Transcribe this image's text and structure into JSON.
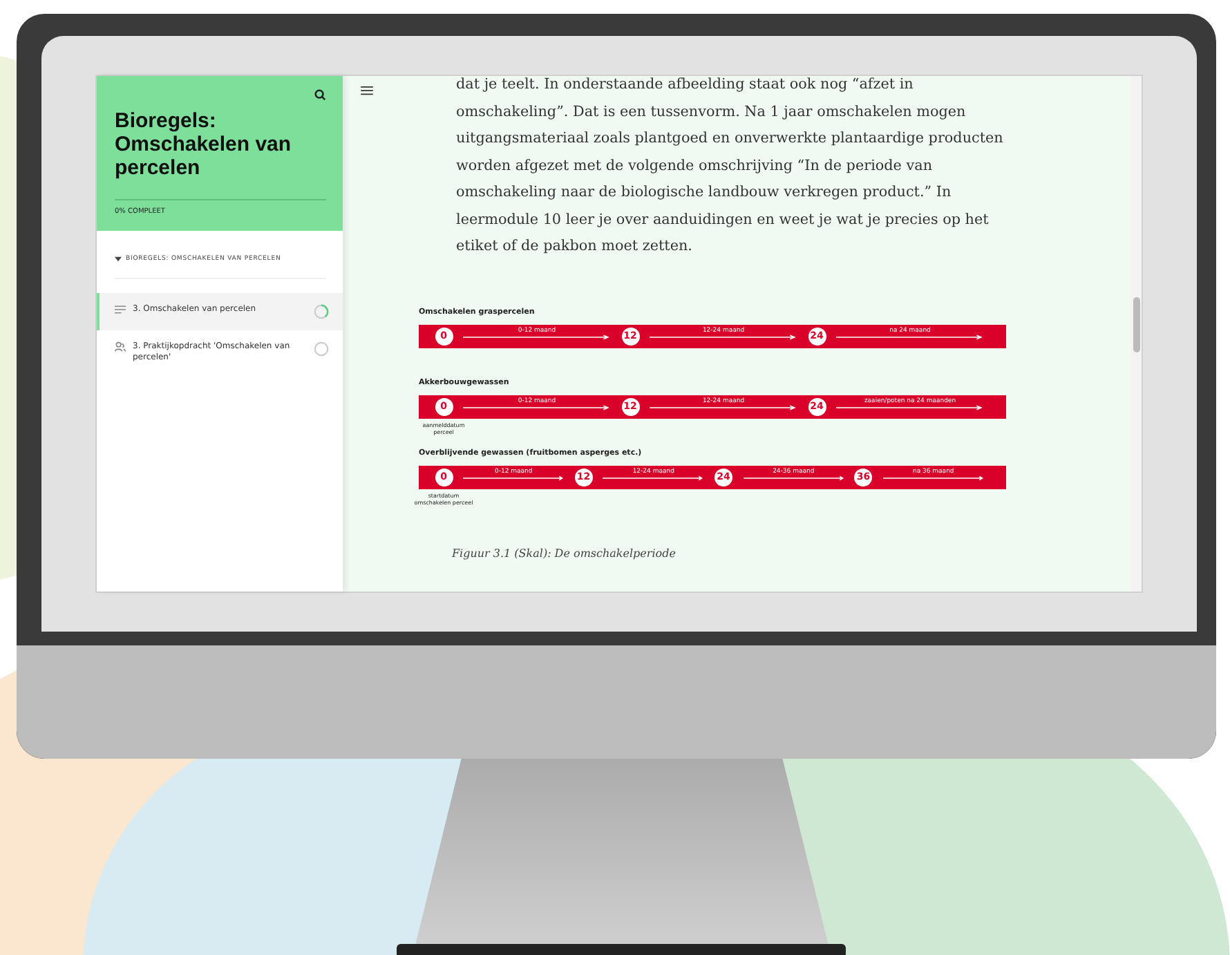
{
  "sidebar": {
    "title": "Bioregels: Omschakelen van percelen",
    "progress": "0% COMPLEET",
    "section": {
      "label": "BIOREGELS: OMSCHAKELEN VAN PERCELEN",
      "expanded": true
    },
    "items": [
      {
        "label": "3. Omschakelen van percelen",
        "kind": "lesson",
        "selected": true,
        "in_progress": true
      },
      {
        "label": "3. Praktijkopdracht 'Omschakelen van percelen'",
        "kind": "assignment",
        "selected": false,
        "in_progress": false
      }
    ]
  },
  "content": {
    "paragraph": "dat je teelt. In onderstaande afbeelding staat ook nog “afzet in omschakeling”. Dat is een tussenvorm. Na 1 jaar omschakelen mogen uitgangsmateriaal zoals plantgoed en onverwerkte plantaardige producten worden afgezet met de volgende omschrijving “In de periode van omschakeling naar de biologische landbouw verkregen product.” In leermodule 10 leer je over aanduidingen en weet je wat je precies op het etiket of de pakbon moet zetten.",
    "timelines": [
      {
        "title": "Omschakelen graspercelen",
        "steps": [
          {
            "milestone": "0",
            "period": "0-12 maand"
          },
          {
            "milestone": "12",
            "period": "12-24 maand"
          },
          {
            "milestone": "24",
            "period": "na 24 maand"
          }
        ]
      },
      {
        "title": "Akkerbouwgewassen",
        "steps": [
          {
            "milestone": "0",
            "note": "aanmelddatum perceel",
            "period": "0-12 maand"
          },
          {
            "milestone": "12",
            "period": "12-24 maand"
          },
          {
            "milestone": "24",
            "period": "zaaien/poten na 24 maanden"
          }
        ]
      },
      {
        "title": "Overblijvende gewassen (fruitbomen asperges etc.)",
        "steps": [
          {
            "milestone": "0",
            "note": "startdatum omschakelen perceel",
            "period": "0-12 maand"
          },
          {
            "milestone": "12",
            "period": "12-24 maand"
          },
          {
            "milestone": "24",
            "period": "24-36 maand"
          },
          {
            "milestone": "36",
            "period": "na 36 maand"
          }
        ]
      }
    ],
    "caption": "Figuur 3.1 (Skal): De omschakelperiode"
  }
}
